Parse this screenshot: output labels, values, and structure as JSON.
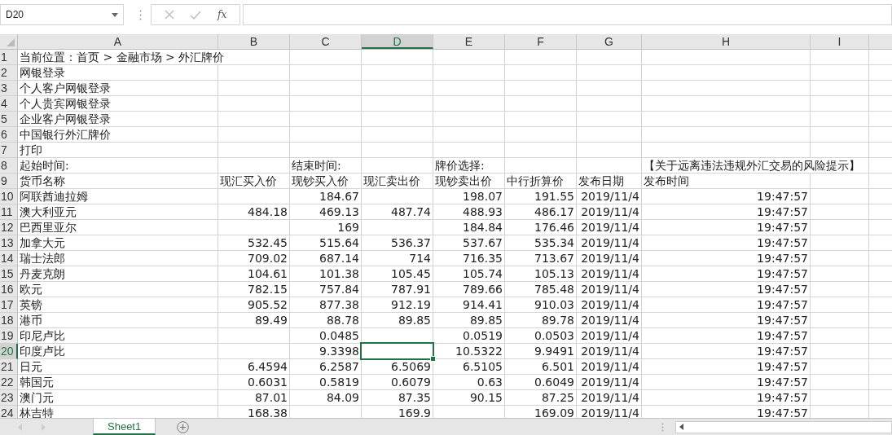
{
  "formula_bar": {
    "name_box": "D20",
    "fx_label": "fx"
  },
  "columns": [
    {
      "label": "A",
      "selected": false
    },
    {
      "label": "B",
      "selected": false
    },
    {
      "label": "C",
      "selected": false
    },
    {
      "label": "D",
      "selected": true
    },
    {
      "label": "E",
      "selected": false
    },
    {
      "label": "F",
      "selected": false
    },
    {
      "label": "G",
      "selected": false
    },
    {
      "label": "H",
      "selected": false
    },
    {
      "label": "I",
      "selected": false
    }
  ],
  "rows": [
    {
      "label": "1",
      "selected": false,
      "cells": [
        {
          "kind": "text",
          "text": "当前位置：首页 > 金融市场 > 外汇牌价"
        }
      ]
    },
    {
      "label": "2",
      "selected": false,
      "cells": [
        {
          "kind": "text",
          "text": "网银登录"
        }
      ]
    },
    {
      "label": "3",
      "selected": false,
      "cells": [
        {
          "kind": "text",
          "text": "个人客户网银登录"
        }
      ]
    },
    {
      "label": "4",
      "selected": false,
      "cells": [
        {
          "kind": "text",
          "text": "个人贵宾网银登录"
        }
      ]
    },
    {
      "label": "5",
      "selected": false,
      "cells": [
        {
          "kind": "text",
          "text": "企业客户网银登录"
        }
      ]
    },
    {
      "label": "6",
      "selected": false,
      "cells": [
        {
          "kind": "text",
          "text": "中国银行外汇牌价"
        }
      ]
    },
    {
      "label": "7",
      "selected": false,
      "cells": [
        {
          "kind": "text",
          "text": "打印"
        }
      ]
    },
    {
      "label": "8",
      "selected": false,
      "cells": [
        {
          "kind": "text",
          "text": "起始时间:"
        },
        {
          "kind": "empty"
        },
        {
          "kind": "text",
          "text": "结束时间:"
        },
        {
          "kind": "empty"
        },
        {
          "kind": "text",
          "text": "牌价选择:"
        },
        {
          "kind": "empty"
        },
        {
          "kind": "empty"
        },
        {
          "kind": "text",
          "text": "【关于远离违法违规外汇交易的风险提示】"
        }
      ]
    },
    {
      "label": "9",
      "selected": false,
      "cells": [
        {
          "kind": "text",
          "text": "货币名称"
        },
        {
          "kind": "text",
          "text": "现汇买入价"
        },
        {
          "kind": "text",
          "text": "现钞买入价"
        },
        {
          "kind": "text",
          "text": "现汇卖出价"
        },
        {
          "kind": "text",
          "text": "现钞卖出价"
        },
        {
          "kind": "text",
          "text": "中行折算价"
        },
        {
          "kind": "text",
          "text": "发布日期"
        },
        {
          "kind": "text",
          "text": "发布时间"
        }
      ]
    },
    {
      "label": "10",
      "selected": false,
      "cells": [
        {
          "kind": "text",
          "text": "阿联酋迪拉姆"
        },
        {
          "kind": "empty"
        },
        {
          "kind": "number",
          "text": "184.67"
        },
        {
          "kind": "empty"
        },
        {
          "kind": "number",
          "text": "198.07"
        },
        {
          "kind": "number",
          "text": "191.55"
        },
        {
          "kind": "date",
          "text": "2019/11/4"
        },
        {
          "kind": "time",
          "text": "19:47:57"
        }
      ]
    },
    {
      "label": "11",
      "selected": false,
      "cells": [
        {
          "kind": "text",
          "text": "澳大利亚元"
        },
        {
          "kind": "number",
          "text": "484.18"
        },
        {
          "kind": "number",
          "text": "469.13"
        },
        {
          "kind": "number",
          "text": "487.74"
        },
        {
          "kind": "number",
          "text": "488.93"
        },
        {
          "kind": "number",
          "text": "486.17"
        },
        {
          "kind": "date",
          "text": "2019/11/4"
        },
        {
          "kind": "time",
          "text": "19:47:57"
        }
      ]
    },
    {
      "label": "12",
      "selected": false,
      "cells": [
        {
          "kind": "text",
          "text": "巴西里亚尔"
        },
        {
          "kind": "empty"
        },
        {
          "kind": "number",
          "text": "169"
        },
        {
          "kind": "empty"
        },
        {
          "kind": "number",
          "text": "184.84"
        },
        {
          "kind": "number",
          "text": "176.46"
        },
        {
          "kind": "date",
          "text": "2019/11/4"
        },
        {
          "kind": "time",
          "text": "19:47:57"
        }
      ]
    },
    {
      "label": "13",
      "selected": false,
      "cells": [
        {
          "kind": "text",
          "text": "加拿大元"
        },
        {
          "kind": "number",
          "text": "532.45"
        },
        {
          "kind": "number",
          "text": "515.64"
        },
        {
          "kind": "number",
          "text": "536.37"
        },
        {
          "kind": "number",
          "text": "537.67"
        },
        {
          "kind": "number",
          "text": "535.34"
        },
        {
          "kind": "date",
          "text": "2019/11/4"
        },
        {
          "kind": "time",
          "text": "19:47:57"
        }
      ]
    },
    {
      "label": "14",
      "selected": false,
      "cells": [
        {
          "kind": "text",
          "text": "瑞士法郎"
        },
        {
          "kind": "number",
          "text": "709.02"
        },
        {
          "kind": "number",
          "text": "687.14"
        },
        {
          "kind": "number",
          "text": "714"
        },
        {
          "kind": "number",
          "text": "716.35"
        },
        {
          "kind": "number",
          "text": "713.67"
        },
        {
          "kind": "date",
          "text": "2019/11/4"
        },
        {
          "kind": "time",
          "text": "19:47:57"
        }
      ]
    },
    {
      "label": "15",
      "selected": false,
      "cells": [
        {
          "kind": "text",
          "text": "丹麦克朗"
        },
        {
          "kind": "number",
          "text": "104.61"
        },
        {
          "kind": "number",
          "text": "101.38"
        },
        {
          "kind": "number",
          "text": "105.45"
        },
        {
          "kind": "number",
          "text": "105.74"
        },
        {
          "kind": "number",
          "text": "105.13"
        },
        {
          "kind": "date",
          "text": "2019/11/4"
        },
        {
          "kind": "time",
          "text": "19:47:57"
        }
      ]
    },
    {
      "label": "16",
      "selected": false,
      "cells": [
        {
          "kind": "text",
          "text": "欧元"
        },
        {
          "kind": "number",
          "text": "782.15"
        },
        {
          "kind": "number",
          "text": "757.84"
        },
        {
          "kind": "number",
          "text": "787.91"
        },
        {
          "kind": "number",
          "text": "789.66"
        },
        {
          "kind": "number",
          "text": "785.48"
        },
        {
          "kind": "date",
          "text": "2019/11/4"
        },
        {
          "kind": "time",
          "text": "19:47:57"
        }
      ]
    },
    {
      "label": "17",
      "selected": false,
      "cells": [
        {
          "kind": "text",
          "text": "英镑"
        },
        {
          "kind": "number",
          "text": "905.52"
        },
        {
          "kind": "number",
          "text": "877.38"
        },
        {
          "kind": "number",
          "text": "912.19"
        },
        {
          "kind": "number",
          "text": "914.41"
        },
        {
          "kind": "number",
          "text": "910.03"
        },
        {
          "kind": "date",
          "text": "2019/11/4"
        },
        {
          "kind": "time",
          "text": "19:47:57"
        }
      ]
    },
    {
      "label": "18",
      "selected": false,
      "cells": [
        {
          "kind": "text",
          "text": "港币"
        },
        {
          "kind": "number",
          "text": "89.49"
        },
        {
          "kind": "number",
          "text": "88.78"
        },
        {
          "kind": "number",
          "text": "89.85"
        },
        {
          "kind": "number",
          "text": "89.85"
        },
        {
          "kind": "number",
          "text": "89.78"
        },
        {
          "kind": "date",
          "text": "2019/11/4"
        },
        {
          "kind": "time",
          "text": "19:47:57"
        }
      ]
    },
    {
      "label": "19",
      "selected": false,
      "cells": [
        {
          "kind": "text",
          "text": "印尼卢比"
        },
        {
          "kind": "empty"
        },
        {
          "kind": "number",
          "text": "0.0485"
        },
        {
          "kind": "empty"
        },
        {
          "kind": "number",
          "text": "0.0519"
        },
        {
          "kind": "number",
          "text": "0.0503"
        },
        {
          "kind": "date",
          "text": "2019/11/4"
        },
        {
          "kind": "time",
          "text": "19:47:57"
        }
      ]
    },
    {
      "label": "20",
      "selected": true,
      "cells": [
        {
          "kind": "text",
          "text": "印度卢比"
        },
        {
          "kind": "empty"
        },
        {
          "kind": "number",
          "text": "9.3398"
        },
        {
          "kind": "empty"
        },
        {
          "kind": "number",
          "text": "10.5322"
        },
        {
          "kind": "number",
          "text": "9.9491"
        },
        {
          "kind": "date",
          "text": "2019/11/4"
        },
        {
          "kind": "time",
          "text": "19:47:57"
        }
      ]
    },
    {
      "label": "21",
      "selected": false,
      "cells": [
        {
          "kind": "text",
          "text": "日元"
        },
        {
          "kind": "number",
          "text": "6.4594"
        },
        {
          "kind": "number",
          "text": "6.2587"
        },
        {
          "kind": "number",
          "text": "6.5069"
        },
        {
          "kind": "number",
          "text": "6.5105"
        },
        {
          "kind": "number",
          "text": "6.501"
        },
        {
          "kind": "date",
          "text": "2019/11/4"
        },
        {
          "kind": "time",
          "text": "19:47:57"
        }
      ]
    },
    {
      "label": "22",
      "selected": false,
      "cells": [
        {
          "kind": "text",
          "text": "韩国元"
        },
        {
          "kind": "number",
          "text": "0.6031"
        },
        {
          "kind": "number",
          "text": "0.5819"
        },
        {
          "kind": "number",
          "text": "0.6079"
        },
        {
          "kind": "number",
          "text": "0.63"
        },
        {
          "kind": "number",
          "text": "0.6049"
        },
        {
          "kind": "date",
          "text": "2019/11/4"
        },
        {
          "kind": "time",
          "text": "19:47:57"
        }
      ]
    },
    {
      "label": "23",
      "selected": false,
      "cells": [
        {
          "kind": "text",
          "text": "澳门元"
        },
        {
          "kind": "number",
          "text": "87.01"
        },
        {
          "kind": "number",
          "text": "84.09"
        },
        {
          "kind": "number",
          "text": "87.35"
        },
        {
          "kind": "number",
          "text": "90.15"
        },
        {
          "kind": "number",
          "text": "87.25"
        },
        {
          "kind": "date",
          "text": "2019/11/4"
        },
        {
          "kind": "time",
          "text": "19:47:57"
        }
      ]
    },
    {
      "label": "24",
      "selected": false,
      "cells": [
        {
          "kind": "text",
          "text": "林吉特"
        },
        {
          "kind": "number",
          "text": "168.38"
        },
        {
          "kind": "empty"
        },
        {
          "kind": "number",
          "text": "169.9"
        },
        {
          "kind": "empty"
        },
        {
          "kind": "number",
          "text": "169.09"
        },
        {
          "kind": "date",
          "text": "2019/11/4"
        },
        {
          "kind": "time",
          "text": "19:47:57"
        }
      ]
    }
  ],
  "sheet_tabs": [
    {
      "label": "Sheet1",
      "selected": true
    }
  ]
}
